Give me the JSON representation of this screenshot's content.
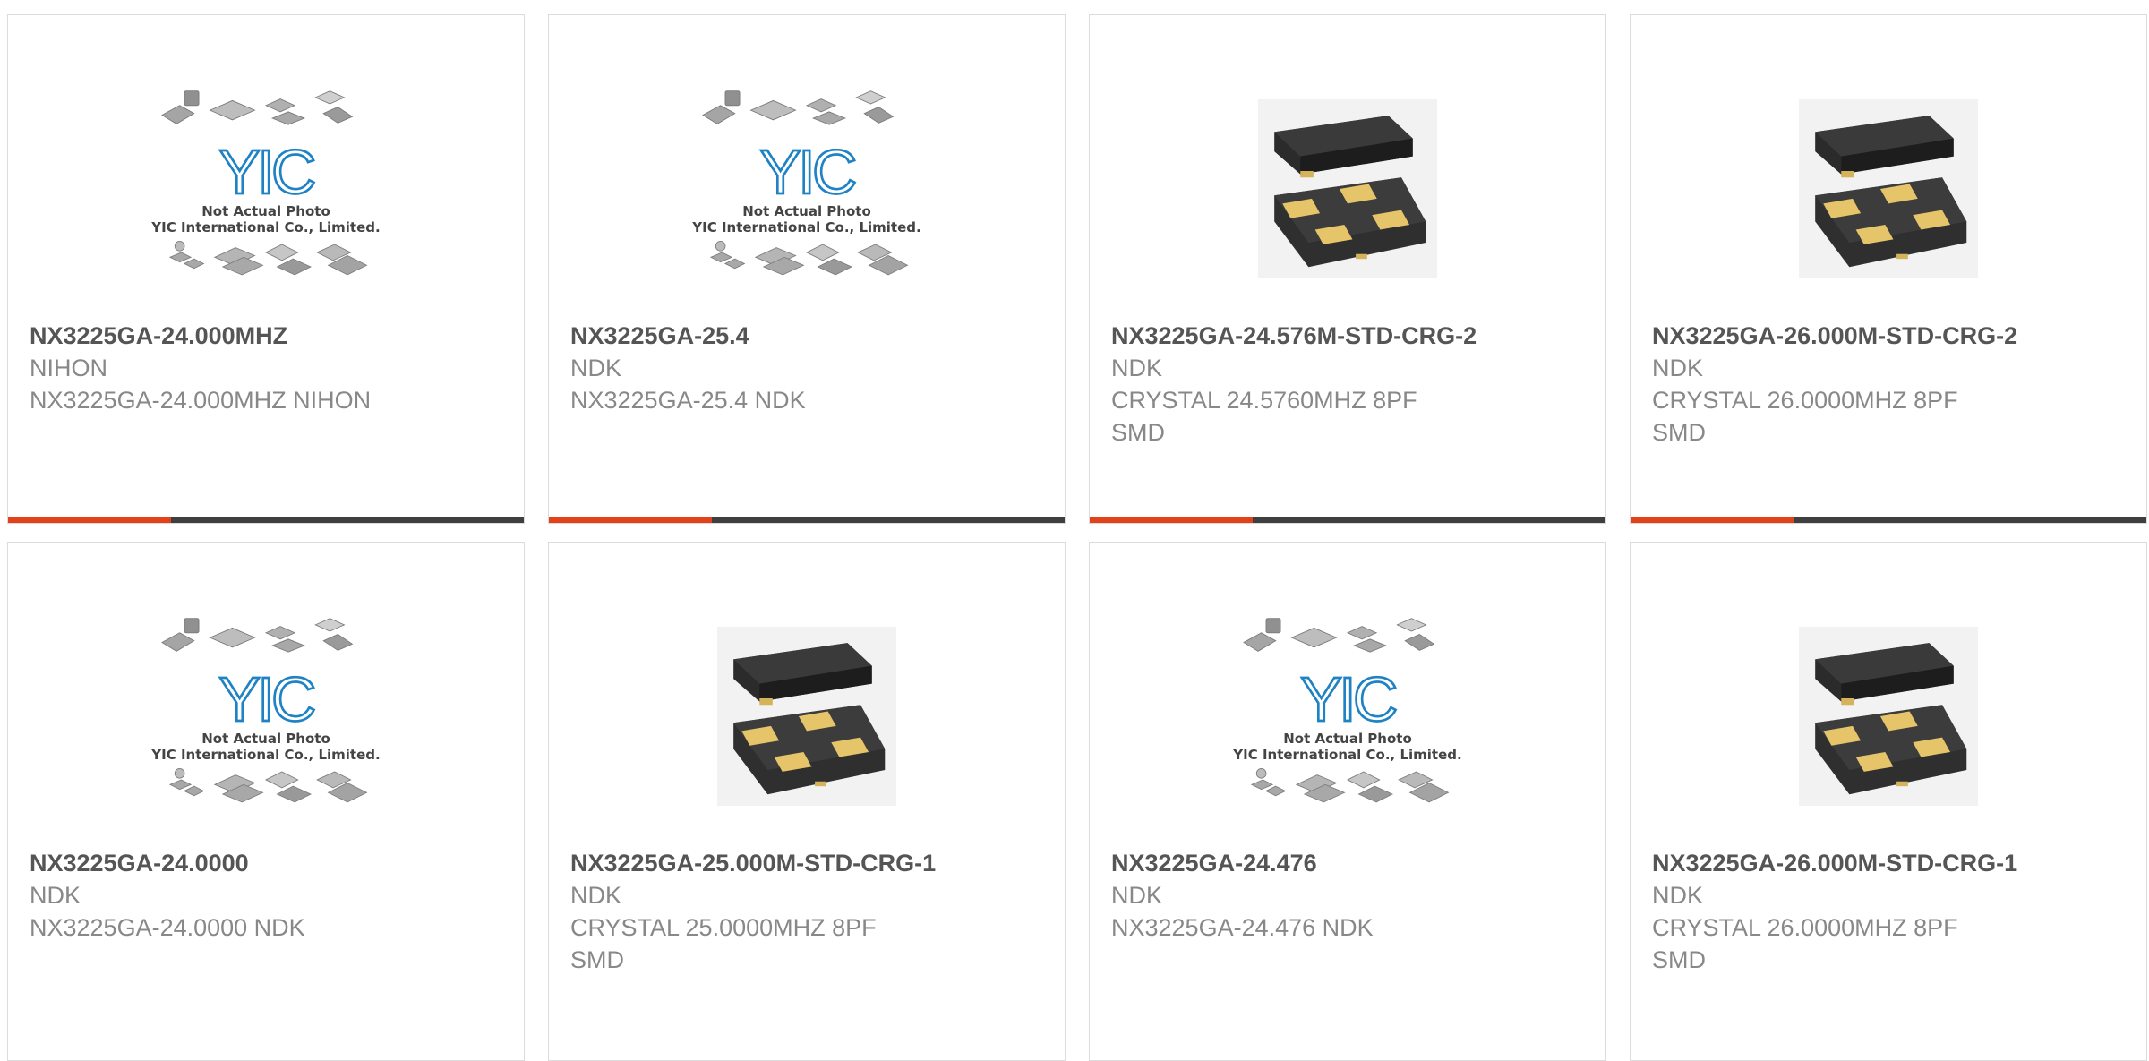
{
  "placeholder": {
    "logo_text": "YIC",
    "line1": "Not Actual Photo",
    "line2": "YIC International Co., Limited."
  },
  "colors": {
    "accent": "#e3411a",
    "bar": "#3f3f3f",
    "logo_blue": "#1f82c4"
  },
  "products": [
    {
      "title": "NX3225GA-24.000MHZ",
      "brand": "NIHON",
      "desc1": "NX3225GA-24.000MHZ NIHON",
      "desc2": "",
      "image": "placeholder"
    },
    {
      "title": "NX3225GA-25.4",
      "brand": "NDK",
      "desc1": "NX3225GA-25.4 NDK",
      "desc2": "",
      "image": "placeholder"
    },
    {
      "title": "NX3225GA-24.576M-STD-CRG-2",
      "brand": "NDK",
      "desc1": "CRYSTAL 24.5760MHZ 8PF",
      "desc2": "SMD",
      "image": "crystal"
    },
    {
      "title": "NX3225GA-26.000M-STD-CRG-2",
      "brand": "NDK",
      "desc1": "CRYSTAL 26.0000MHZ 8PF",
      "desc2": "SMD",
      "image": "crystal"
    },
    {
      "title": "NX3225GA-24.0000",
      "brand": "NDK",
      "desc1": "NX3225GA-24.0000 NDK",
      "desc2": "",
      "image": "placeholder"
    },
    {
      "title": "NX3225GA-25.000M-STD-CRG-1",
      "brand": "NDK",
      "desc1": "CRYSTAL 25.0000MHZ 8PF",
      "desc2": "SMD",
      "image": "crystal"
    },
    {
      "title": "NX3225GA-24.476",
      "brand": "NDK",
      "desc1": "NX3225GA-24.476 NDK",
      "desc2": "",
      "image": "placeholder"
    },
    {
      "title": "NX3225GA-26.000M-STD-CRG-1",
      "brand": "NDK",
      "desc1": "CRYSTAL 26.0000MHZ 8PF",
      "desc2": "SMD",
      "image": "crystal"
    }
  ]
}
